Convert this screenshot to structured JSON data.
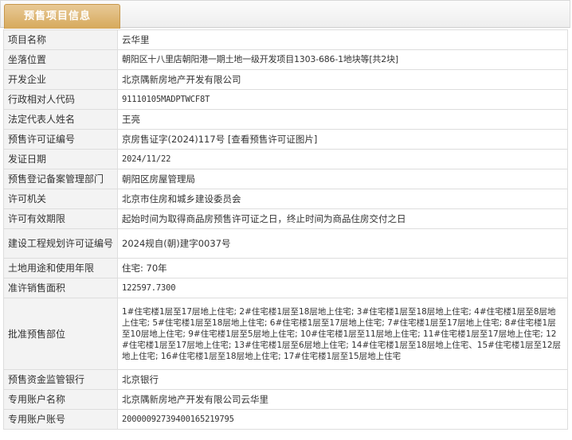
{
  "tab": {
    "label": "预售项目信息"
  },
  "rows": [
    {
      "label": "项目名称",
      "value": "云华里"
    },
    {
      "label": "坐落位置",
      "value": "朝阳区十八里店朝阳港一期土地一级开发项目1303-686-1地块等[共2块]"
    },
    {
      "label": "开发企业",
      "value": "北京隅新房地产开发有限公司"
    },
    {
      "label": "行政相对人代码",
      "value": "91110105MADPTWCF8T"
    },
    {
      "label": "法定代表人姓名",
      "value": "王亮"
    },
    {
      "label": "预售许可证编号",
      "value": "京房售证字(2024)117号",
      "link": "[查看预售许可证图片]"
    },
    {
      "label": "发证日期",
      "value": "2024/11/22"
    },
    {
      "label": "预售登记备案管理部门",
      "value": "朝阳区房屋管理局"
    },
    {
      "label": "许可机关",
      "value": "北京市住房和城乡建设委员会"
    },
    {
      "label": "许可有效期限",
      "value": "起始时间为取得商品房预售许可证之日，终止时间为商品住房交付之日"
    },
    {
      "label": "建设工程规划许可证编号",
      "value": "2024规自(朝)建字0037号"
    },
    {
      "label": "土地用途和使用年限",
      "value": "住宅: 70年"
    },
    {
      "label": "准许销售面积",
      "value": "122597.7300"
    },
    {
      "label": "批准预售部位",
      "value": "1#住宅楼1层至17层地上住宅; 2#住宅楼1层至18层地上住宅; 3#住宅楼1层至18层地上住宅; 4#住宅楼1层至8层地上住宅; 5#住宅楼1层至18层地上住宅; 6#住宅楼1层至17层地上住宅; 7#住宅楼1层至17层地上住宅; 8#住宅楼1层至10层地上住宅; 9#住宅楼1层至5层地上住宅; 10#住宅楼1层至11层地上住宅; 11#住宅楼1层至17层地上住宅; 12#住宅楼1层至17层地上住宅; 13#住宅楼1层至6层地上住宅; 14#住宅楼1层至18层地上住宅、15#住宅楼1层至12层地上住宅; 16#住宅楼1层至18层地上住宅; 17#住宅楼1层至15层地上住宅"
    },
    {
      "label": "预售资金监管银行",
      "value": "北京银行"
    },
    {
      "label": "专用账户名称",
      "value": "北京隅新房地产开发有限公司云华里"
    },
    {
      "label": "专用账户账号",
      "value": "20000092739400165219795"
    }
  ]
}
